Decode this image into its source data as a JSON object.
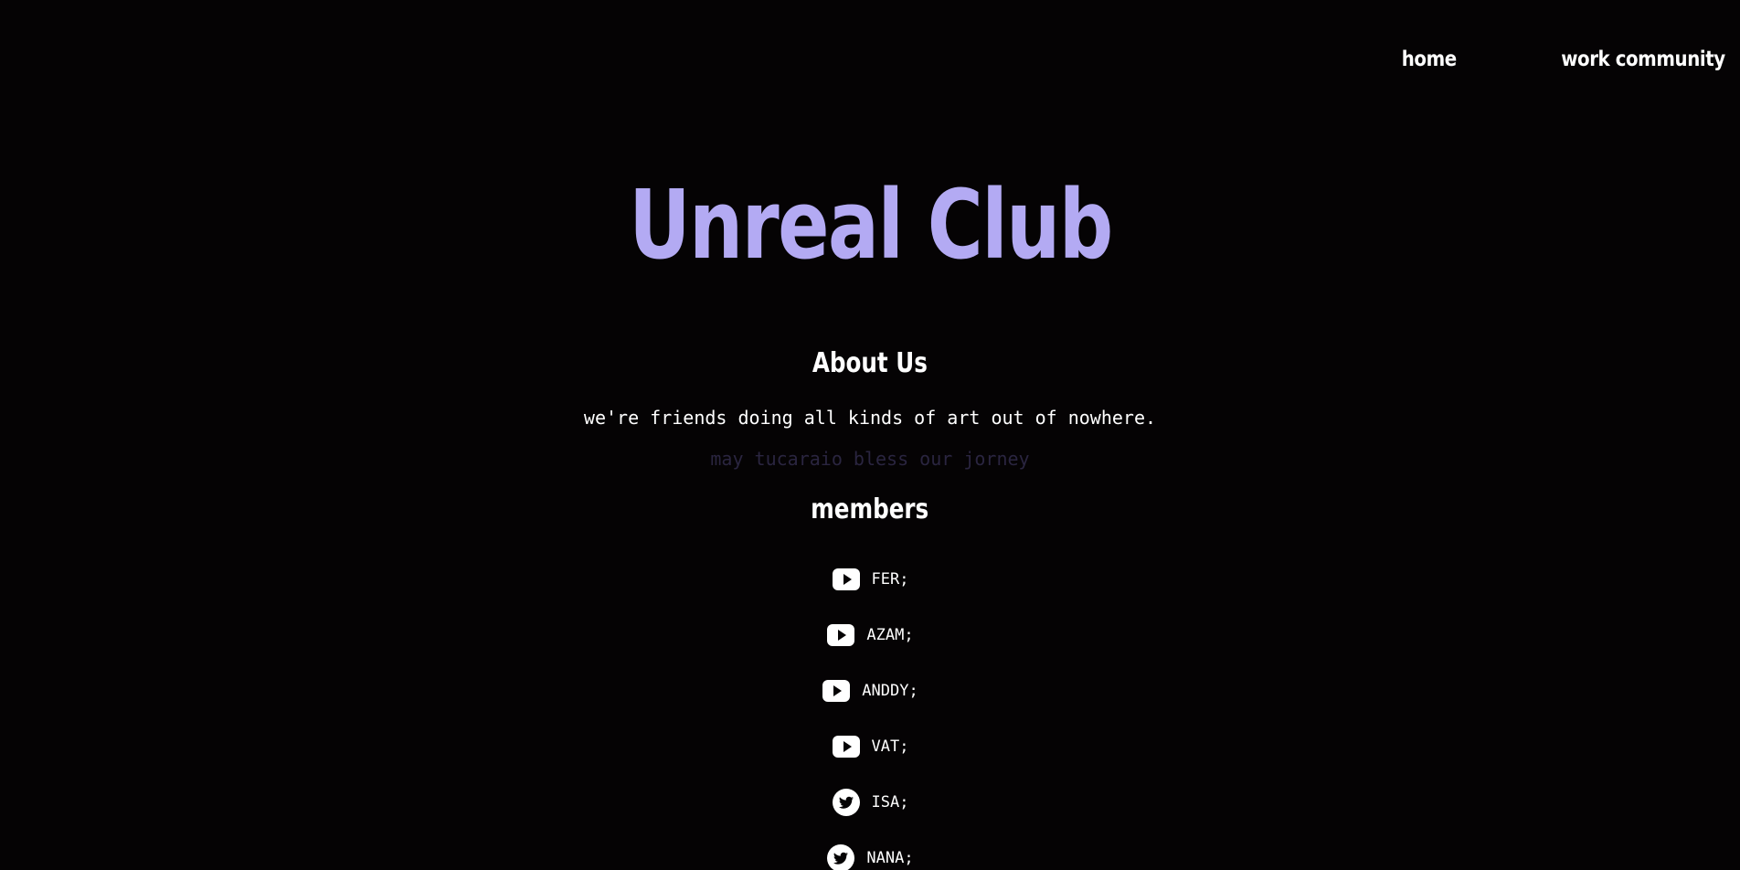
{
  "nav": {
    "items": [
      {
        "label": "home"
      },
      {
        "label": "work community"
      }
    ]
  },
  "hero": {
    "title": "Unreal Club"
  },
  "about": {
    "heading": "About Us",
    "text": "we're friends doing all kinds of art out of nowhere.",
    "blessing": "may tucaraio bless our jorney"
  },
  "members": {
    "heading": "members",
    "list": [
      {
        "name": "FER;",
        "icon": "youtube-icon"
      },
      {
        "name": "AZAM;",
        "icon": "youtube-icon"
      },
      {
        "name": "ANDDY;",
        "icon": "youtube-icon"
      },
      {
        "name": "VAT;",
        "icon": "youtube-icon"
      },
      {
        "name": "ISA;",
        "icon": "twitter-icon"
      },
      {
        "name": "NANA;",
        "icon": "twitter-icon"
      }
    ]
  },
  "colors": {
    "background": "#050304",
    "title": "#b3aaf3",
    "text": "#ffffff",
    "muted": "#2a2540"
  }
}
